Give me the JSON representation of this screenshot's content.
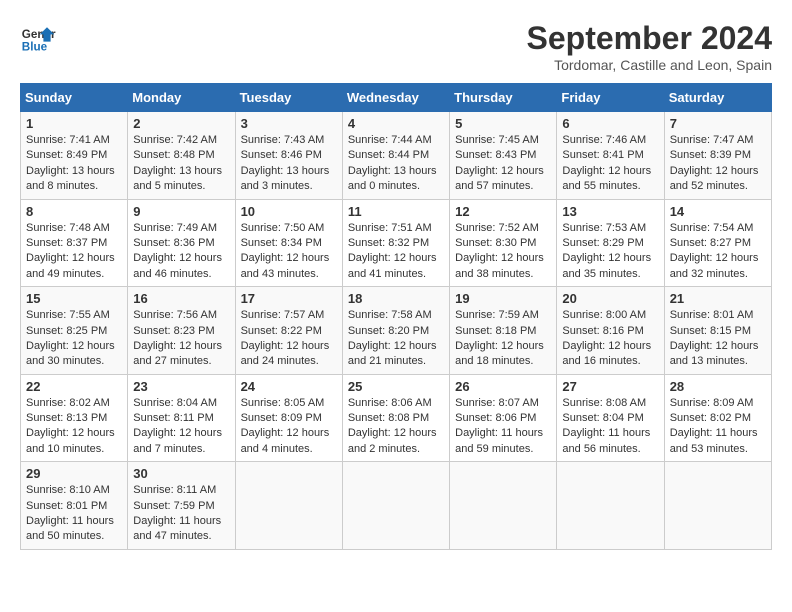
{
  "header": {
    "logo_line1": "General",
    "logo_line2": "Blue",
    "month": "September 2024",
    "location": "Tordomar, Castille and Leon, Spain"
  },
  "days_of_week": [
    "Sunday",
    "Monday",
    "Tuesday",
    "Wednesday",
    "Thursday",
    "Friday",
    "Saturday"
  ],
  "weeks": [
    [
      {
        "day": "1",
        "info": "Sunrise: 7:41 AM\nSunset: 8:49 PM\nDaylight: 13 hours\nand 8 minutes."
      },
      {
        "day": "2",
        "info": "Sunrise: 7:42 AM\nSunset: 8:48 PM\nDaylight: 13 hours\nand 5 minutes."
      },
      {
        "day": "3",
        "info": "Sunrise: 7:43 AM\nSunset: 8:46 PM\nDaylight: 13 hours\nand 3 minutes."
      },
      {
        "day": "4",
        "info": "Sunrise: 7:44 AM\nSunset: 8:44 PM\nDaylight: 13 hours\nand 0 minutes."
      },
      {
        "day": "5",
        "info": "Sunrise: 7:45 AM\nSunset: 8:43 PM\nDaylight: 12 hours\nand 57 minutes."
      },
      {
        "day": "6",
        "info": "Sunrise: 7:46 AM\nSunset: 8:41 PM\nDaylight: 12 hours\nand 55 minutes."
      },
      {
        "day": "7",
        "info": "Sunrise: 7:47 AM\nSunset: 8:39 PM\nDaylight: 12 hours\nand 52 minutes."
      }
    ],
    [
      {
        "day": "8",
        "info": "Sunrise: 7:48 AM\nSunset: 8:37 PM\nDaylight: 12 hours\nand 49 minutes."
      },
      {
        "day": "9",
        "info": "Sunrise: 7:49 AM\nSunset: 8:36 PM\nDaylight: 12 hours\nand 46 minutes."
      },
      {
        "day": "10",
        "info": "Sunrise: 7:50 AM\nSunset: 8:34 PM\nDaylight: 12 hours\nand 43 minutes."
      },
      {
        "day": "11",
        "info": "Sunrise: 7:51 AM\nSunset: 8:32 PM\nDaylight: 12 hours\nand 41 minutes."
      },
      {
        "day": "12",
        "info": "Sunrise: 7:52 AM\nSunset: 8:30 PM\nDaylight: 12 hours\nand 38 minutes."
      },
      {
        "day": "13",
        "info": "Sunrise: 7:53 AM\nSunset: 8:29 PM\nDaylight: 12 hours\nand 35 minutes."
      },
      {
        "day": "14",
        "info": "Sunrise: 7:54 AM\nSunset: 8:27 PM\nDaylight: 12 hours\nand 32 minutes."
      }
    ],
    [
      {
        "day": "15",
        "info": "Sunrise: 7:55 AM\nSunset: 8:25 PM\nDaylight: 12 hours\nand 30 minutes."
      },
      {
        "day": "16",
        "info": "Sunrise: 7:56 AM\nSunset: 8:23 PM\nDaylight: 12 hours\nand 27 minutes."
      },
      {
        "day": "17",
        "info": "Sunrise: 7:57 AM\nSunset: 8:22 PM\nDaylight: 12 hours\nand 24 minutes."
      },
      {
        "day": "18",
        "info": "Sunrise: 7:58 AM\nSunset: 8:20 PM\nDaylight: 12 hours\nand 21 minutes."
      },
      {
        "day": "19",
        "info": "Sunrise: 7:59 AM\nSunset: 8:18 PM\nDaylight: 12 hours\nand 18 minutes."
      },
      {
        "day": "20",
        "info": "Sunrise: 8:00 AM\nSunset: 8:16 PM\nDaylight: 12 hours\nand 16 minutes."
      },
      {
        "day": "21",
        "info": "Sunrise: 8:01 AM\nSunset: 8:15 PM\nDaylight: 12 hours\nand 13 minutes."
      }
    ],
    [
      {
        "day": "22",
        "info": "Sunrise: 8:02 AM\nSunset: 8:13 PM\nDaylight: 12 hours\nand 10 minutes."
      },
      {
        "day": "23",
        "info": "Sunrise: 8:04 AM\nSunset: 8:11 PM\nDaylight: 12 hours\nand 7 minutes."
      },
      {
        "day": "24",
        "info": "Sunrise: 8:05 AM\nSunset: 8:09 PM\nDaylight: 12 hours\nand 4 minutes."
      },
      {
        "day": "25",
        "info": "Sunrise: 8:06 AM\nSunset: 8:08 PM\nDaylight: 12 hours\nand 2 minutes."
      },
      {
        "day": "26",
        "info": "Sunrise: 8:07 AM\nSunset: 8:06 PM\nDaylight: 11 hours\nand 59 minutes."
      },
      {
        "day": "27",
        "info": "Sunrise: 8:08 AM\nSunset: 8:04 PM\nDaylight: 11 hours\nand 56 minutes."
      },
      {
        "day": "28",
        "info": "Sunrise: 8:09 AM\nSunset: 8:02 PM\nDaylight: 11 hours\nand 53 minutes."
      }
    ],
    [
      {
        "day": "29",
        "info": "Sunrise: 8:10 AM\nSunset: 8:01 PM\nDaylight: 11 hours\nand 50 minutes."
      },
      {
        "day": "30",
        "info": "Sunrise: 8:11 AM\nSunset: 7:59 PM\nDaylight: 11 hours\nand 47 minutes."
      },
      null,
      null,
      null,
      null,
      null
    ]
  ]
}
